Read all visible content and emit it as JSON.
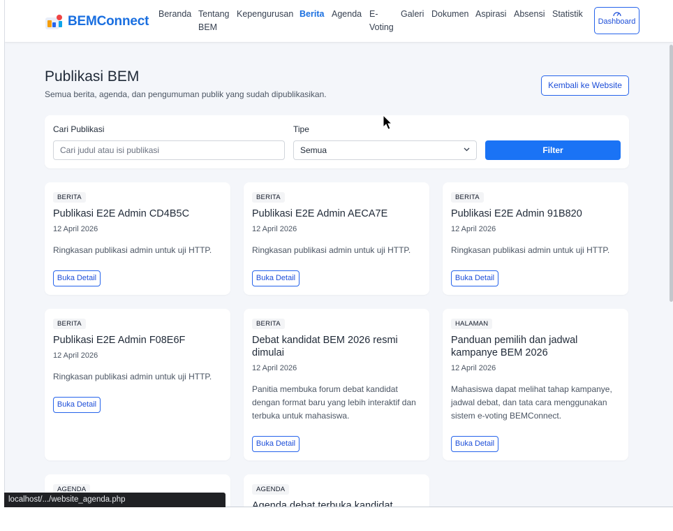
{
  "brand": {
    "name": "BEMConnect",
    "logo_icon": "bemconnect-logo-icon"
  },
  "nav": {
    "items": [
      {
        "label": "Beranda",
        "active": false
      },
      {
        "label": "Tentang BEM",
        "active": false
      },
      {
        "label": "Kepengurusan",
        "active": false
      },
      {
        "label": "Berita",
        "active": true
      },
      {
        "label": "Agenda",
        "active": false
      },
      {
        "label": "E-Voting",
        "active": false
      },
      {
        "label": "Galeri",
        "active": false
      },
      {
        "label": "Dokumen",
        "active": false
      },
      {
        "label": "Aspirasi",
        "active": false
      },
      {
        "label": "Absensi",
        "active": false
      },
      {
        "label": "Statistik",
        "active": false
      }
    ],
    "dashboard_label": "Dashboard",
    "dashboard_icon": "gauge-icon"
  },
  "page": {
    "title": "Publikasi BEM",
    "subtitle": "Semua berita, agenda, dan pengumuman publik yang sudah dipublikasikan.",
    "back_label": "Kembali ke Website"
  },
  "filter": {
    "search_label": "Cari Publikasi",
    "search_placeholder": "Cari judul atau isi publikasi",
    "type_label": "Tipe",
    "type_value": "Semua",
    "submit_label": "Filter"
  },
  "cards": [
    {
      "type": "BERITA",
      "title": "Publikasi E2E Admin CD4B5C",
      "date": "12 April 2026",
      "summary": "Ringkasan publikasi admin untuk uji HTTP.",
      "button": "Buka Detail"
    },
    {
      "type": "BERITA",
      "title": "Publikasi E2E Admin AECA7E",
      "date": "12 April 2026",
      "summary": "Ringkasan publikasi admin untuk uji HTTP.",
      "button": "Buka Detail"
    },
    {
      "type": "BERITA",
      "title": "Publikasi E2E Admin 91B820",
      "date": "12 April 2026",
      "summary": "Ringkasan publikasi admin untuk uji HTTP.",
      "button": "Buka Detail"
    },
    {
      "type": "BERITA",
      "title": "Publikasi E2E Admin F08E6F",
      "date": "12 April 2026",
      "summary": "Ringkasan publikasi admin untuk uji HTTP.",
      "button": "Buka Detail"
    },
    {
      "type": "BERITA",
      "title": "Debat kandidat BEM 2026 resmi dimulai",
      "date": "12 April 2026",
      "summary": "Panitia membuka forum debat kandidat dengan format baru yang lebih interaktif dan terbuka untuk mahasiswa.",
      "button": "Buka Detail"
    },
    {
      "type": "HALAMAN",
      "title": "Panduan pemilih dan jadwal kampanye BEM 2026",
      "date": "12 April 2026",
      "summary": "Mahasiswa dapat melihat tahap kampanye, jadwal debat, dan tata cara menggunakan sistem e-voting BEMConnect.",
      "button": "Buka Detail"
    },
    {
      "type": "AGENDA",
      "title": ""
    },
    {
      "type": "AGENDA",
      "title": "Agenda debat terbuka kandidat"
    }
  ],
  "status_bar": {
    "url": "localhost/.../website_agenda.php"
  },
  "colors": {
    "accent": "#1a6fe0",
    "primary_button": "#1a73f5",
    "background": "#f4f6fa"
  }
}
